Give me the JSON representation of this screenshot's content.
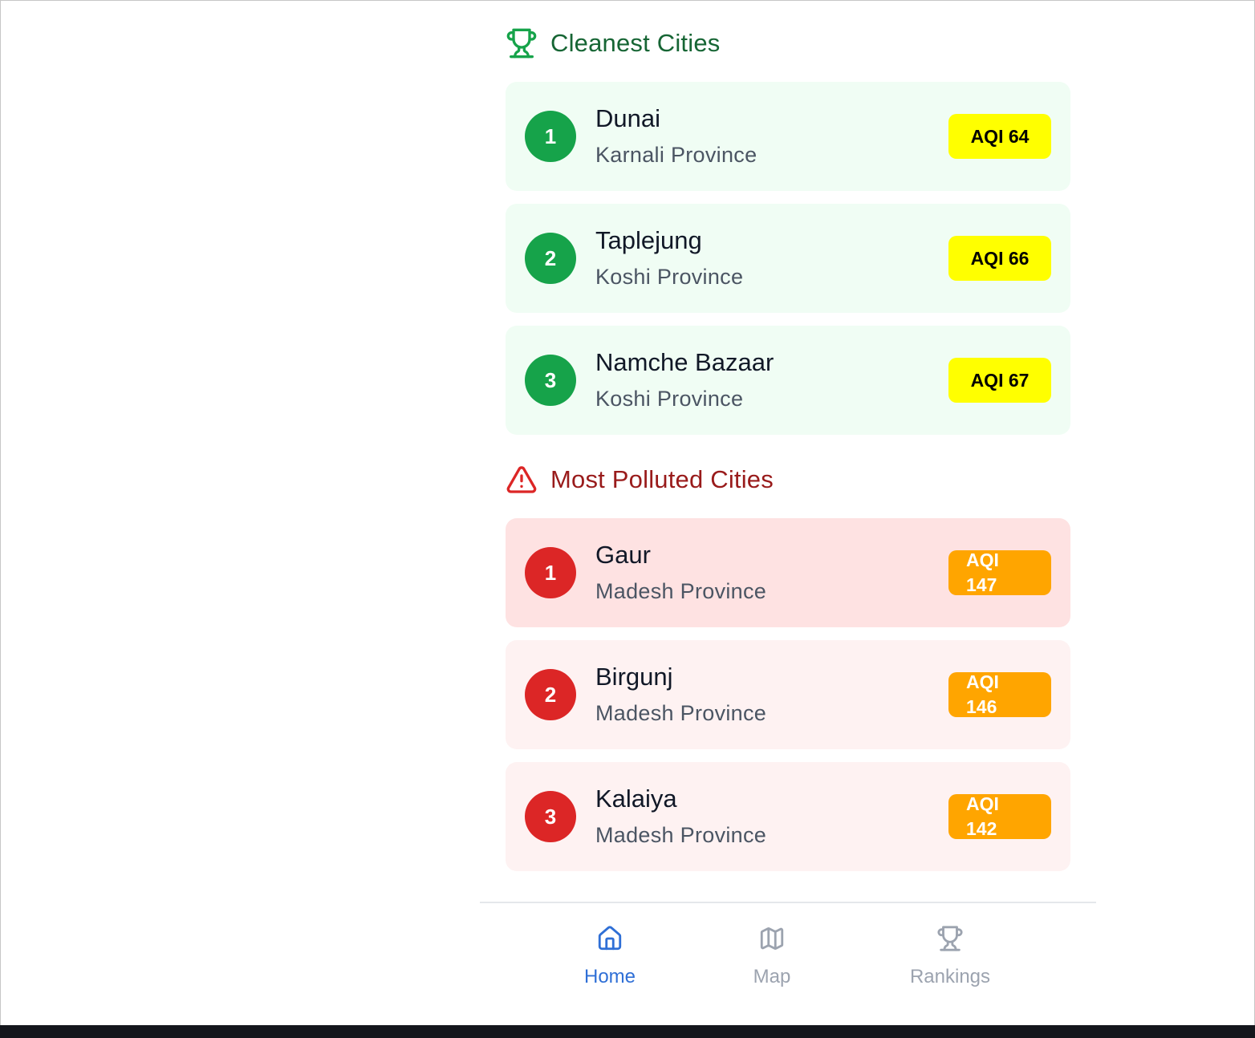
{
  "sections": {
    "cleanest": {
      "title": "Cleanest Cities",
      "icon": "trophy-icon",
      "color": "#166534",
      "items": [
        {
          "rank": "1",
          "city": "Dunai",
          "province": "Karnali Province",
          "aqi": "AQI 64"
        },
        {
          "rank": "2",
          "city": "Taplejung",
          "province": "Koshi Province",
          "aqi": "AQI 66"
        },
        {
          "rank": "3",
          "city": "Namche Bazaar",
          "province": "Koshi Province",
          "aqi": "AQI 67"
        }
      ]
    },
    "polluted": {
      "title": "Most Polluted Cities",
      "icon": "warning-triangle-icon",
      "color": "#991b1b",
      "items": [
        {
          "rank": "1",
          "city": "Gaur",
          "province": "Madesh Province",
          "aqi": "AQI 147"
        },
        {
          "rank": "2",
          "city": "Birgunj",
          "province": "Madesh Province",
          "aqi": "AQI 146"
        },
        {
          "rank": "3",
          "city": "Kalaiya",
          "province": "Madesh Province",
          "aqi": "AQI 142"
        }
      ]
    }
  },
  "colors": {
    "aqi_moderate": "#ffff00",
    "aqi_unhealthy_sensitive": "#ffa500",
    "nav_active": "#2f6fd6",
    "nav_inactive": "#9ca3af"
  },
  "bottom_nav": {
    "items": [
      {
        "label": "Home",
        "icon": "home-icon",
        "active": true
      },
      {
        "label": "Map",
        "icon": "map-icon",
        "active": false
      },
      {
        "label": "Rankings",
        "icon": "trophy-icon",
        "active": false
      }
    ]
  }
}
